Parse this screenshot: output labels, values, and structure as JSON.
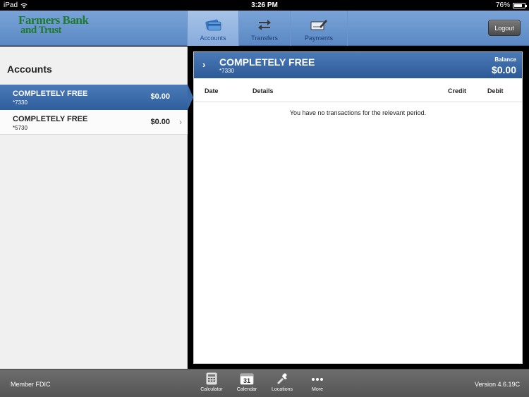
{
  "status_bar": {
    "device": "iPad",
    "time": "3:26 PM",
    "battery": "76%"
  },
  "header": {
    "logo_line1": "Farmers Bank",
    "logo_line2": "and Trust",
    "tabs": [
      {
        "label": "Accounts",
        "icon": "card-icon",
        "active": true
      },
      {
        "label": "Transfers",
        "icon": "transfer-arrows-icon",
        "active": false
      },
      {
        "label": "Payments",
        "icon": "check-pen-icon",
        "active": false
      }
    ],
    "logout_label": "Logout"
  },
  "accounts_pane": {
    "title": "Accounts",
    "items": [
      {
        "name": "COMPLETELY FREE",
        "number": "*7330",
        "balance": "$0.00",
        "selected": true
      },
      {
        "name": "COMPLETELY FREE",
        "number": "*5730",
        "balance": "$0.00",
        "selected": false
      }
    ]
  },
  "detail": {
    "account_name": "COMPLETELY FREE",
    "account_number": "*7330",
    "balance_label": "Balance",
    "balance_value": "$0.00",
    "columns": [
      "Date",
      "Details",
      "Credit",
      "Debit"
    ],
    "empty_message": "You have no transactions for the relevant period."
  },
  "footer": {
    "left_text": "Member FDIC",
    "version": "Version 4.6.19C",
    "tools": [
      {
        "label": "Calculator",
        "icon": "calculator-icon"
      },
      {
        "label": "Calendar",
        "icon": "calendar-icon",
        "badge": "31"
      },
      {
        "label": "Locations",
        "icon": "location-pin-icon"
      },
      {
        "label": "More",
        "icon": "more-dots-icon"
      }
    ]
  }
}
